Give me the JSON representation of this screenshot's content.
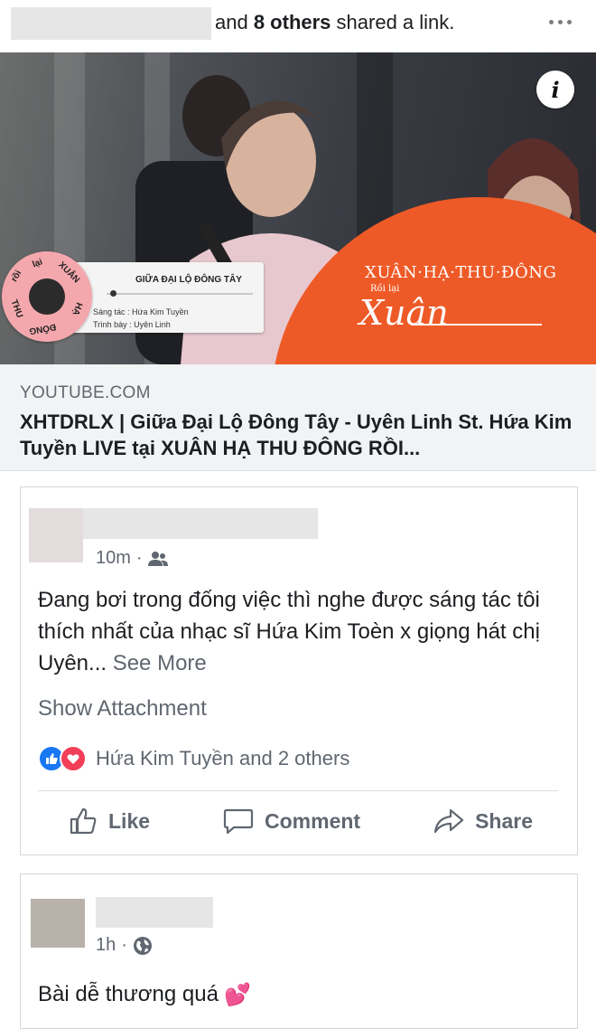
{
  "share_header": {
    "text_pre": "and ",
    "others_bold": "8 others",
    "text_post": " shared a link."
  },
  "link_preview": {
    "image": {
      "info_icon": "info-icon",
      "brand_title": "XUÂN·HẠ·THU·ĐÔNG",
      "brand_sub": "Rồi lại",
      "brand_script": "Xuân",
      "player_title": "GIỮA ĐẠI LỘ ĐÔNG TÂY",
      "player_composer": "Sáng tác  : Hứa Kim Tuyền",
      "player_performer": "Trình bày : Uyên Linh",
      "disc_text_1": "lại",
      "disc_text_2": "rồi",
      "disc_text_3": "XUÂN",
      "disc_text_4": "THU",
      "disc_text_5": "ĐÔNG",
      "disc_text_6": "HẠ",
      "accent_color": "#ee5a27"
    },
    "domain": "YOUTUBE.COM",
    "title": "XHTDRLX | Giữa Đại Lộ Đông Tây - Uyên Linh St. Hứa Kim Tuyền LIVE tại XUÂN HẠ THU ĐÔNG RỒI..."
  },
  "comments": [
    {
      "time": "10m",
      "audience_icon": "friends-icon",
      "text": "Đang bơi trong đống việc thì nghe được sáng tác tôi thích nhất của nhạc sĩ Hứa Kim Toèn x giọng hát chị Uyên...",
      "see_more": "See More",
      "show_attachment": "Show Attachment",
      "reactions_text": "Hứa Kim Tuyền and 2 others",
      "actions": {
        "like": "Like",
        "comment": "Comment",
        "share": "Share"
      }
    },
    {
      "time": "1h",
      "audience_icon": "globe-icon",
      "text": "Bài dễ thương quá",
      "emoji": "💕"
    }
  ]
}
